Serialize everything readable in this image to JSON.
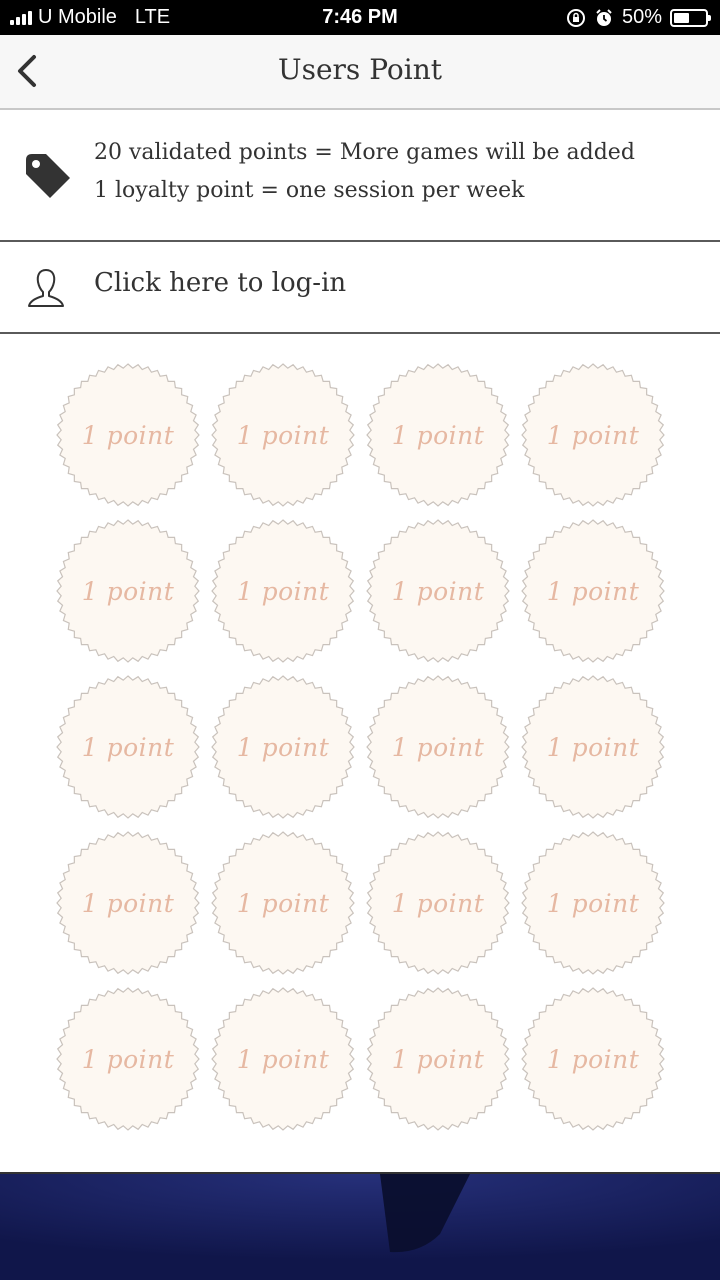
{
  "status_bar": {
    "carrier": "U Mobile",
    "network": "LTE",
    "time": "7:46 PM",
    "battery": "50%",
    "battery_level": 0.5
  },
  "nav": {
    "title": "Users Point",
    "back_icon": "chevron-left-icon"
  },
  "info": {
    "icon": "tag-icon",
    "line1": "20 validated points = More games will be added",
    "line2": "1 loyalty point = one session per week"
  },
  "login": {
    "icon": "user-icon",
    "label": "Click here to log-in"
  },
  "points": {
    "badge_label": "1 point",
    "rows": 5,
    "columns": 4,
    "badges": [
      "1 point",
      "1 point",
      "1 point",
      "1 point",
      "1 point",
      "1 point",
      "1 point",
      "1 point",
      "1 point",
      "1 point",
      "1 point",
      "1 point",
      "1 point",
      "1 point",
      "1 point",
      "1 point",
      "1 point",
      "1 point",
      "1 point",
      "1 point"
    ]
  },
  "colors": {
    "badge_fill": "#fdf8f2",
    "badge_stroke": "#c9c2bc",
    "badge_text": "#e6b8a2",
    "banner": "#151c56"
  }
}
